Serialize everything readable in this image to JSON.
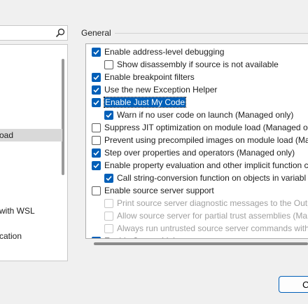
{
  "search": {
    "placeholder": ""
  },
  "tree": {
    "items": [
      {
        "label": "oad",
        "selected": true
      },
      {
        "label": "with WSL",
        "selected": false
      },
      {
        "label": "cation",
        "selected": false
      }
    ]
  },
  "general": {
    "title": "General",
    "options": [
      {
        "label": "Enable address-level debugging",
        "checked": true,
        "indent": 0
      },
      {
        "label": "Show disassembly if source is not available",
        "checked": false,
        "indent": 1
      },
      {
        "label": "Enable breakpoint filters",
        "checked": true,
        "indent": 0
      },
      {
        "label": "Use the new Exception Helper",
        "checked": true,
        "indent": 0
      },
      {
        "label": "Enable Just My Code",
        "checked": true,
        "indent": 0,
        "focused": true
      },
      {
        "label": "Warn if no user code on launch (Managed only)",
        "checked": true,
        "indent": 1
      },
      {
        "label": "Suppress JIT optimization on module load (Managed on",
        "checked": false,
        "indent": 0
      },
      {
        "label": "Prevent using precompiled images on module load (Man",
        "checked": false,
        "indent": 0
      },
      {
        "label": "Step over properties and operators (Managed only)",
        "checked": true,
        "indent": 0
      },
      {
        "label": "Enable property evaluation and other implicit function c",
        "checked": true,
        "indent": 0
      },
      {
        "label": "Call string-conversion function on objects in variabl",
        "checked": true,
        "indent": 1
      },
      {
        "label": "Enable source server support",
        "checked": false,
        "indent": 0
      },
      {
        "label": "Print source server diagnostic messages to the Outp",
        "checked": false,
        "indent": 1,
        "disabled": true
      },
      {
        "label": "Allow source server for partial trust assemblies (Man",
        "checked": false,
        "indent": 1,
        "disabled": true
      },
      {
        "label": "Always run untrusted source server commands with",
        "checked": false,
        "indent": 1,
        "disabled": true
      },
      {
        "label": "Enable Source Link support",
        "checked": true,
        "indent": 0
      }
    ]
  },
  "buttons": {
    "ok_label": "C"
  }
}
